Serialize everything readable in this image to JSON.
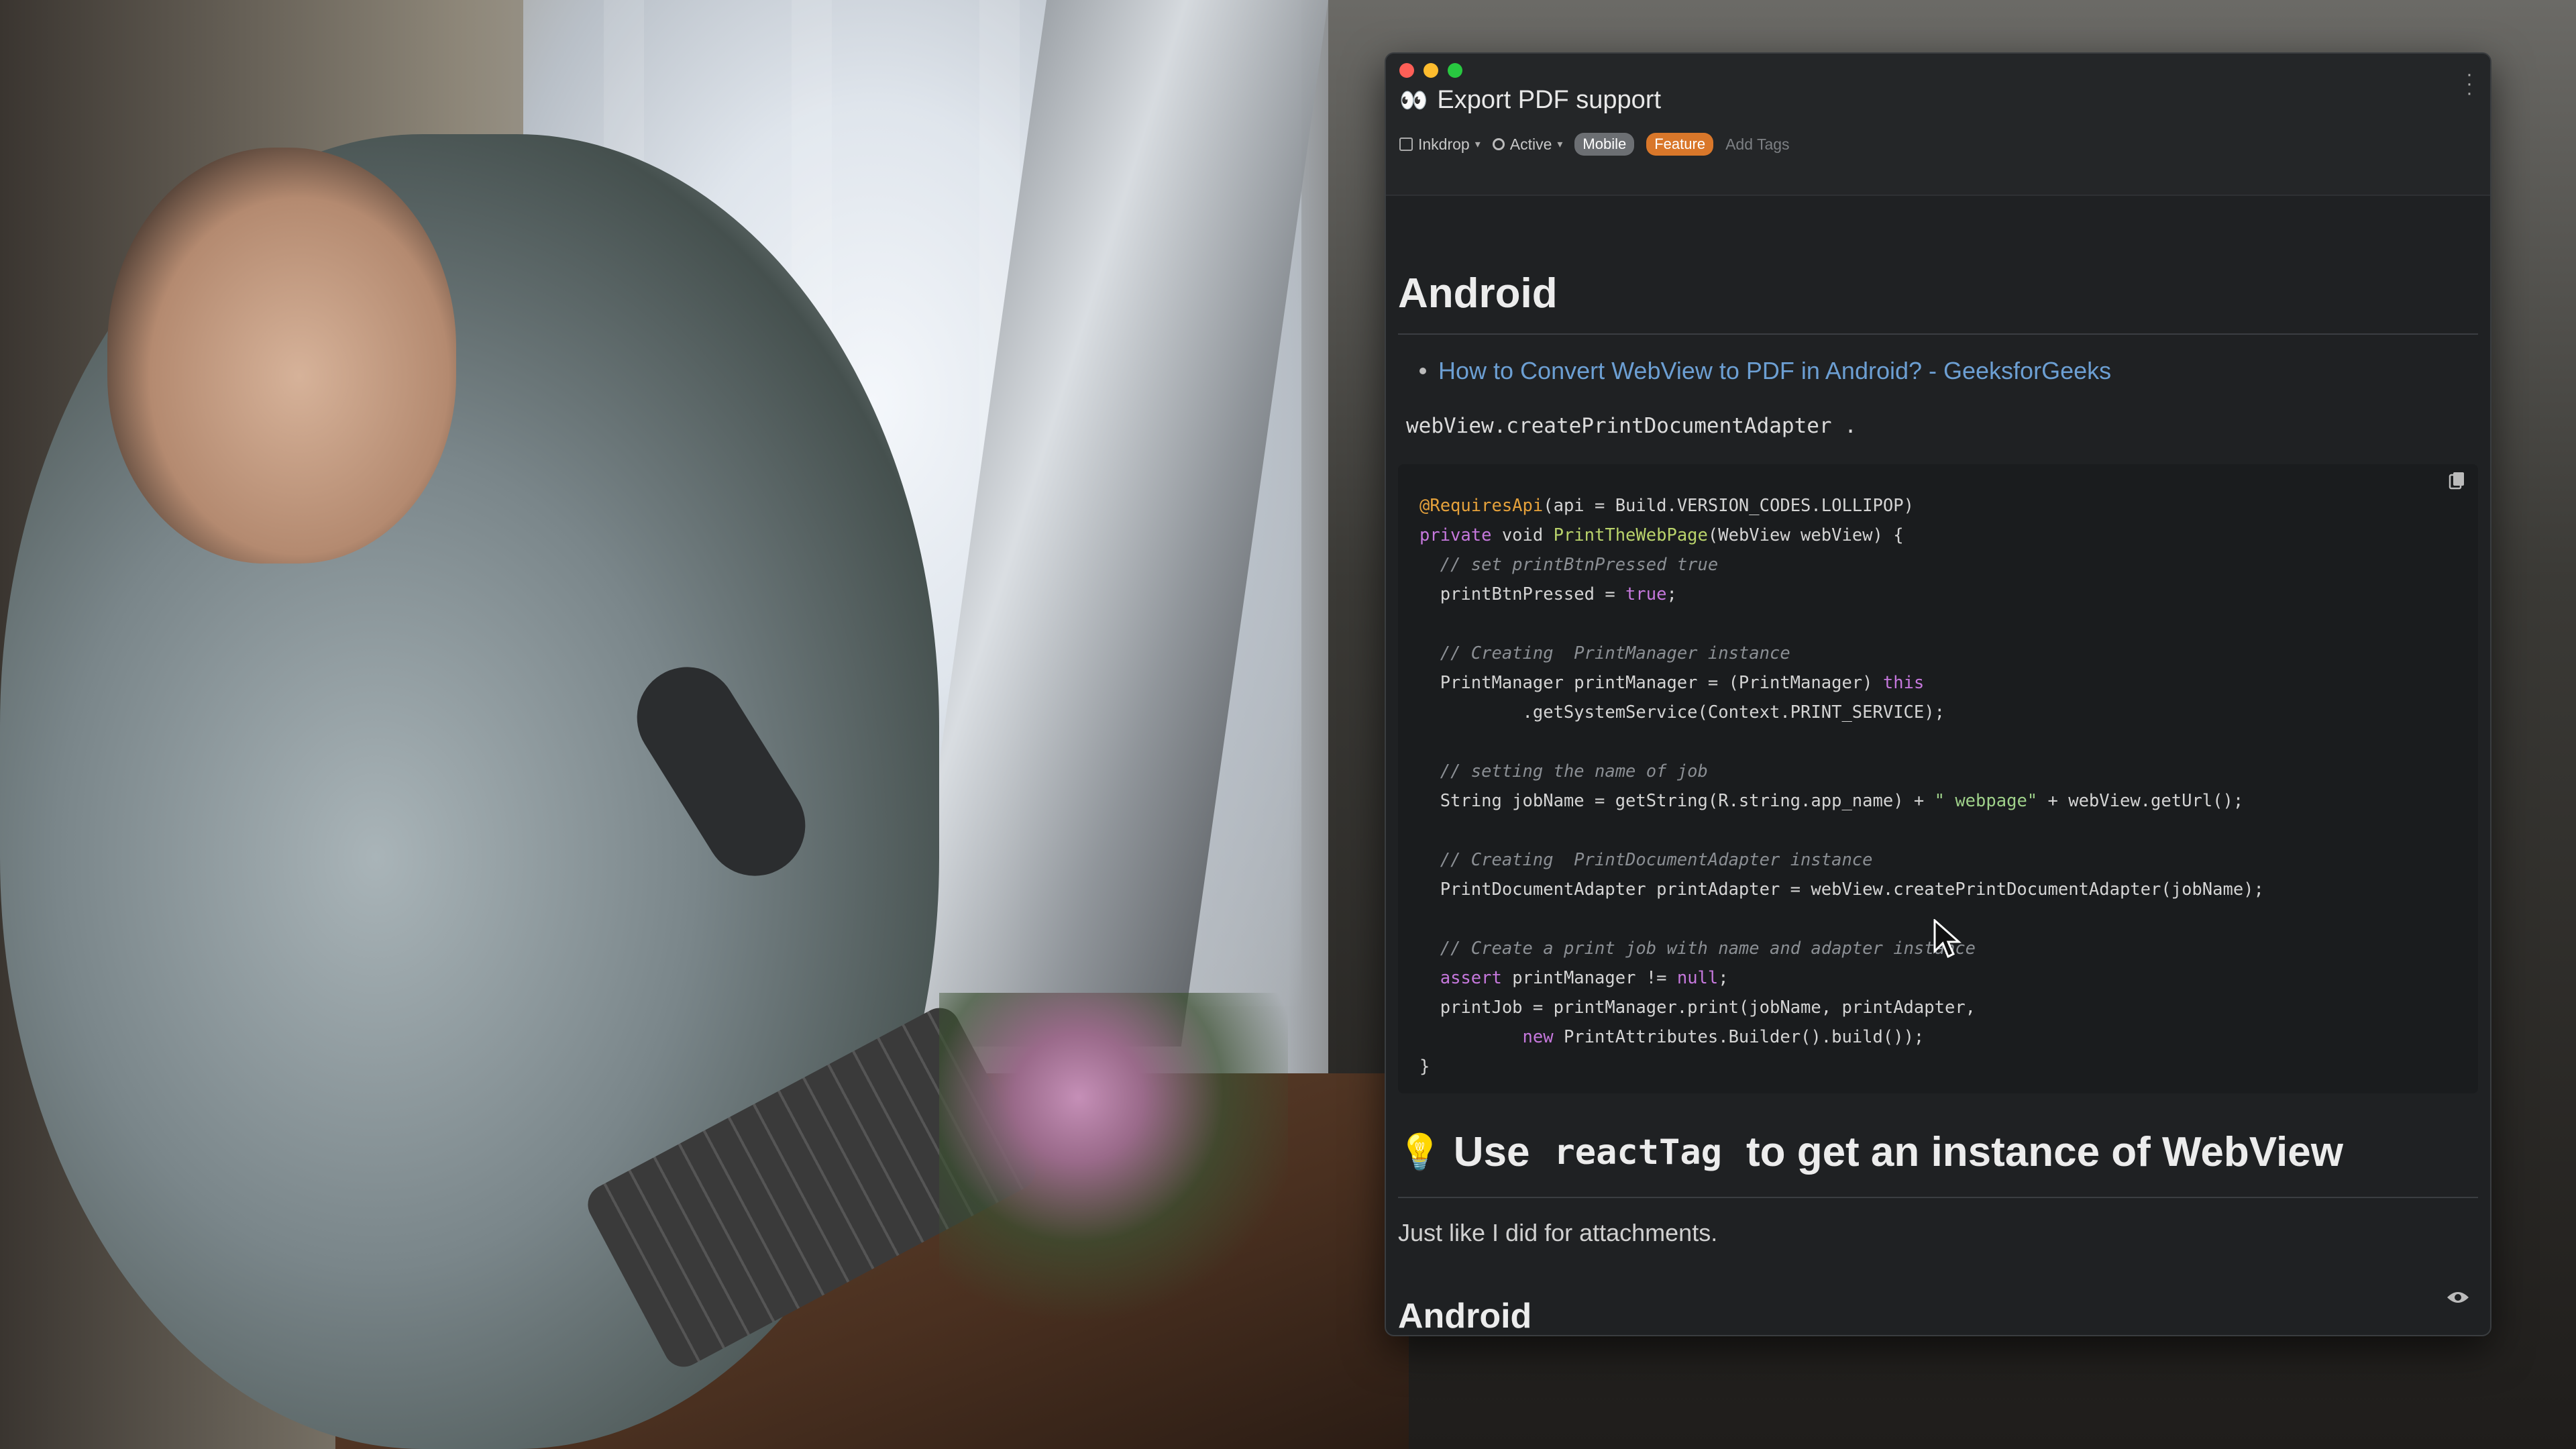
{
  "window": {
    "title": "Export PDF support",
    "title_icon": "eyes-icon",
    "notebook": "Inkdrop",
    "status": "Active",
    "tags": [
      "Mobile",
      "Feature"
    ],
    "add_tags_label": "Add Tags"
  },
  "note": {
    "heading1": "Android",
    "link_text": "How to Convert WebView to PDF in Android? - GeeksforGeeks",
    "inline_code": "webView.createPrintDocumentAdapter",
    "inline_code_suffix": " .",
    "tip_heading_prefix": "Use",
    "tip_heading_code": "reactTag",
    "tip_heading_suffix": "to get an instance of WebView",
    "paragraph": "Just like I did for attachments.",
    "heading2": "Android"
  },
  "colors": {
    "link": "#6c9fd3",
    "tag_mobile": "#6c6f73",
    "tag_feature": "#d9772a",
    "background": "#1f2123"
  }
}
